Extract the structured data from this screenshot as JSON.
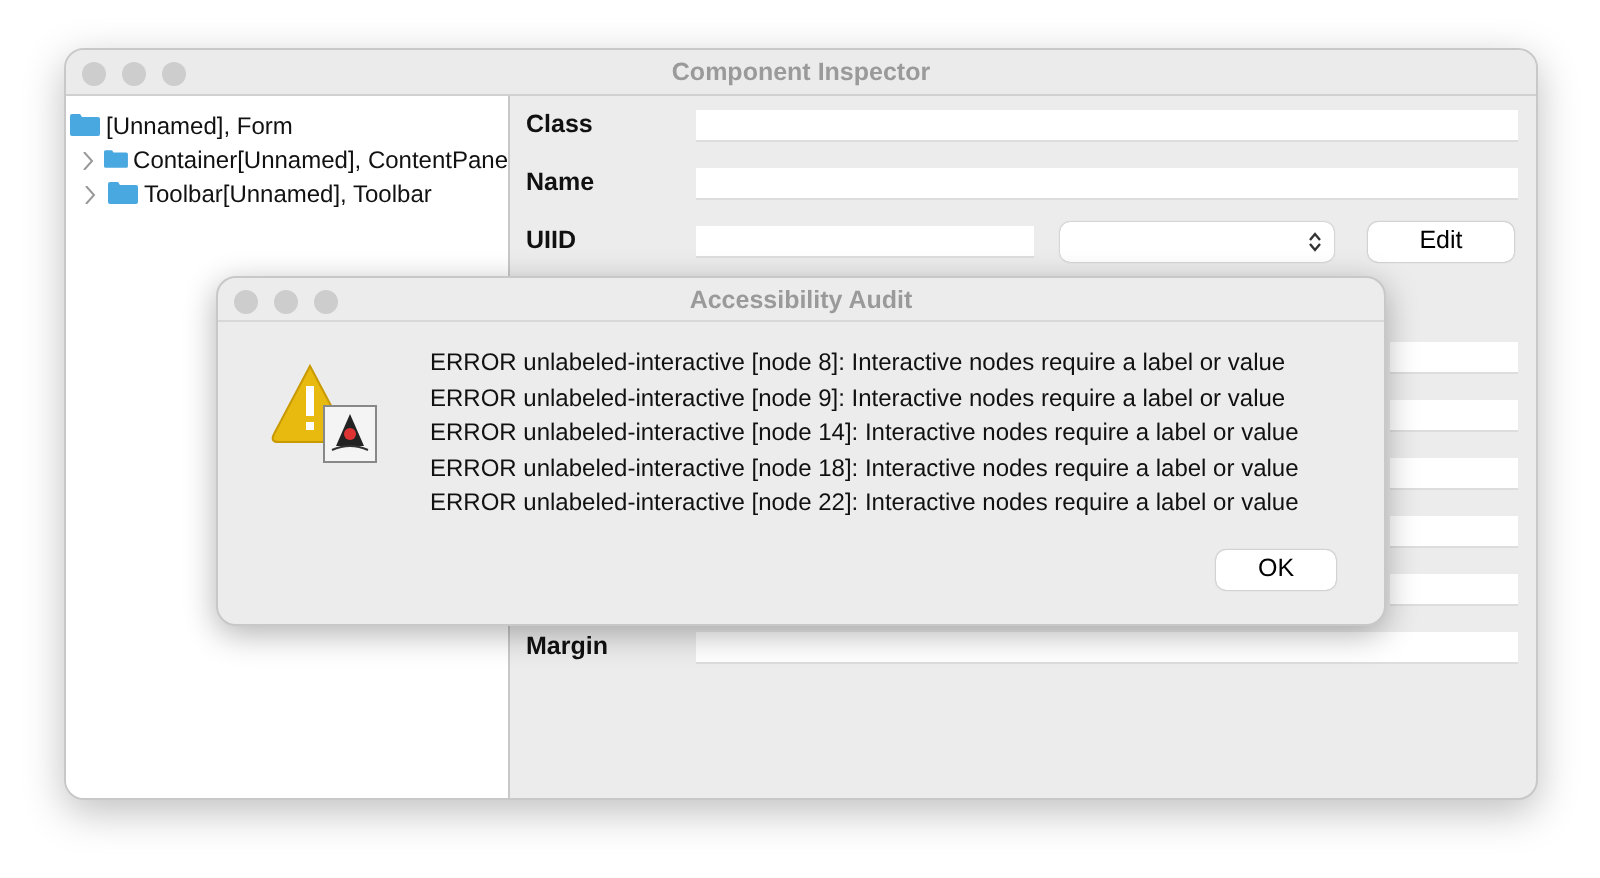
{
  "window": {
    "title": "Component Inspector"
  },
  "tree": [
    {
      "label": "[Unnamed], Form",
      "children": [
        {
          "label": "Container[Unnamed], ContentPane",
          "expanded": false
        },
        {
          "label": "Toolbar[Unnamed], Toolbar",
          "expanded": false
        }
      ]
    }
  ],
  "properties": [
    {
      "kind": "text",
      "label": "Class"
    },
    {
      "kind": "text",
      "label": "Name"
    },
    {
      "kind": "uiid",
      "label": "UIID",
      "button": "Edit"
    },
    {
      "kind": "covered"
    },
    {
      "kind": "covered"
    },
    {
      "kind": "covered"
    },
    {
      "kind": "covered"
    },
    {
      "kind": "covered"
    },
    {
      "kind": "text",
      "label": "Margin"
    }
  ],
  "dialog": {
    "title": "Accessibility Audit",
    "messages": [
      "ERROR unlabeled-interactive [node 8]: Interactive nodes require a label or value",
      "ERROR unlabeled-interactive [node 9]: Interactive nodes require a label or value",
      "ERROR unlabeled-interactive [node 14]: Interactive nodes require a label or value",
      "ERROR unlabeled-interactive [node 18]: Interactive nodes require a label or value",
      "ERROR unlabeled-interactive [node 22]: Interactive nodes require a label or value"
    ],
    "button": "OK"
  }
}
